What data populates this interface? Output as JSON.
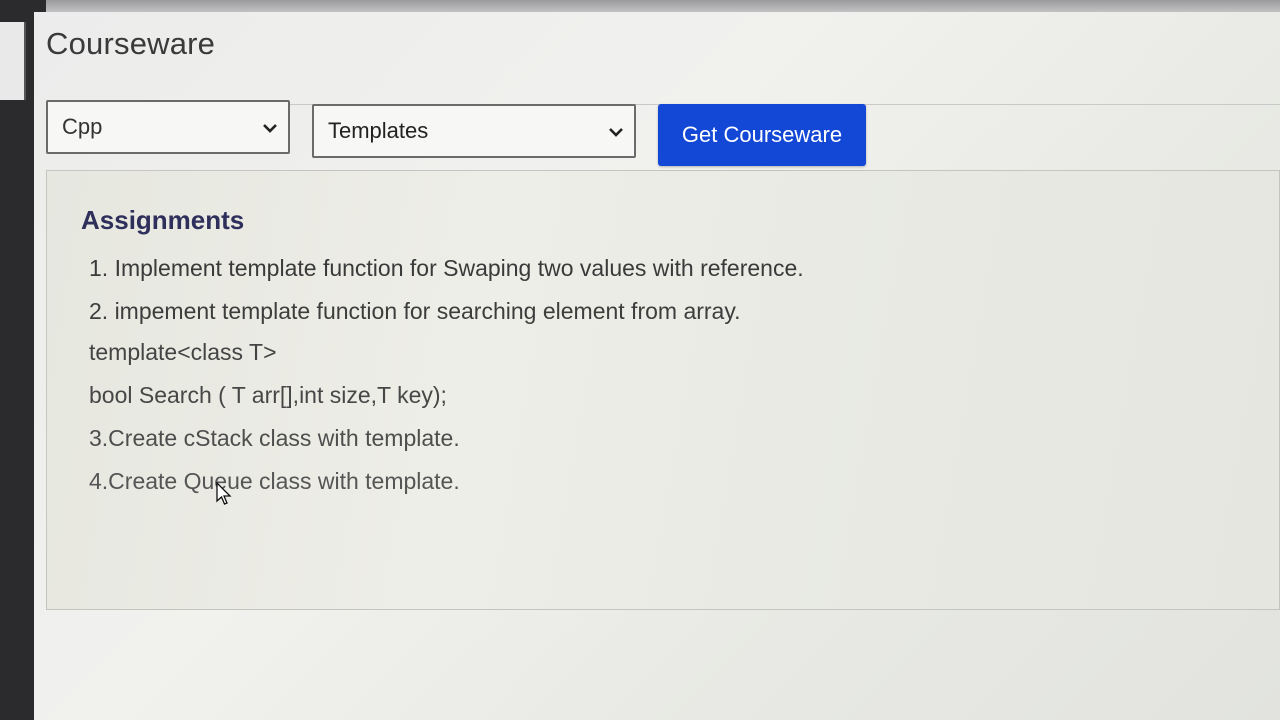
{
  "app": {
    "title": "Courseware"
  },
  "filters": {
    "language": {
      "selected": "Cpp"
    },
    "topic": {
      "selected": "Templates"
    },
    "submit_label": "Get Courseware"
  },
  "assignments": {
    "heading": "Assignments",
    "lines": [
      "1. Implement template function for Swaping two values with reference.",
      "2. impement template function for searching element from array.",
      "template<class T>",
      "bool Search ( T arr[],int size,T key);",
      "3.Create cStack class with template.",
      "4.Create Queue  class with template."
    ]
  },
  "colors": {
    "accent_button": "#1347d6",
    "heading": "#2e2f5a"
  },
  "icons": {
    "dropdown": "chevron-down-icon",
    "pointer": "mouse-cursor-icon"
  }
}
